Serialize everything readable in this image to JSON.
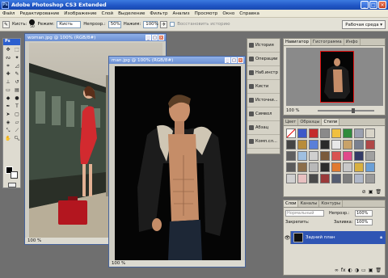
{
  "app": {
    "title": "Adobe Photoshop CS3 Extended",
    "logo_text": "Ps"
  },
  "menu": [
    "Файл",
    "Редактирование",
    "Изображение",
    "Слой",
    "Выделение",
    "Фильтр",
    "Анализ",
    "Просмотр",
    "Окно",
    "Справка"
  ],
  "options": {
    "brush_label": "Кисть:",
    "brush_size": "50",
    "mode_label": "Режим:",
    "mode_value": "Кисть",
    "opacity_label": "Непрозр.:",
    "opacity_value": "50%",
    "pressure_label": "Нажим:",
    "pressure_value": "100%",
    "restore_label": "Восстановить историю",
    "workspace_label": "Рабочая среда ▾"
  },
  "documents": [
    {
      "title": "woman.jpg @ 100% (RGB/8#)",
      "zoom": "100 %"
    },
    {
      "title": "man.jpg @ 100% (RGB/8#)",
      "zoom": "100 %"
    }
  ],
  "dock": [
    "История",
    "Операции",
    "Наб.инстр",
    "Кисти",
    "Источни...",
    "Символ",
    "Абзац",
    "Комп.сл..."
  ],
  "navigator": {
    "tabs": [
      "Навигатор",
      "Гистограмма",
      "Инфо"
    ],
    "zoom": "100 %"
  },
  "styles_panel": {
    "tabs": [
      "Цвет",
      "Образцы",
      "Стили"
    ]
  },
  "layers": {
    "tabs": [
      "Слои",
      "Каналы",
      "Контуры"
    ],
    "blend_mode": "Нормальный",
    "opacity_label": "Непрозр.:",
    "opacity_value": "100%",
    "lock_label": "Закрепить:",
    "fill_label": "Заливка:",
    "fill_value": "100%",
    "layer_name": "Задний план"
  },
  "colors": {
    "title_bar": "#1f55c4",
    "layer_selected": "#2f55b4"
  }
}
